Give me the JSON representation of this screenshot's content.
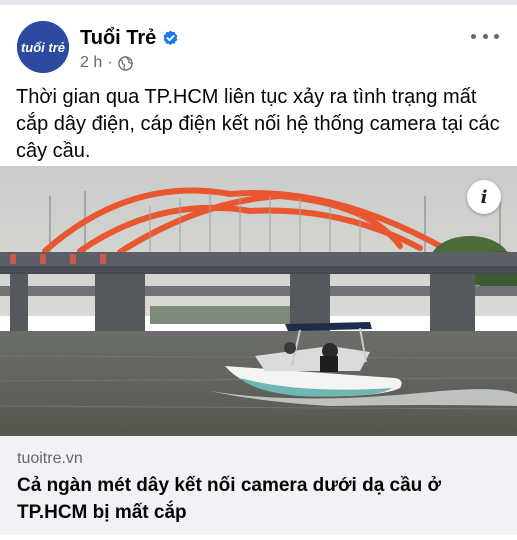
{
  "post": {
    "page_name": "Tuổi Trẻ",
    "avatar_text": "tuổi trẻ",
    "time": "2 h",
    "separator": "·",
    "body": "Thời gian qua TP.HCM liên tục xảy ra tình trạng mất cắp dây điện, cáp điện kết nối hệ thống camera tại các cây cầu."
  },
  "link_preview": {
    "domain": "tuoitre.vn",
    "title": "Cả ngàn mét dây kết nối camera dưới dạ cầu ở TP.HCM bị mất cắp",
    "info_label": "i"
  },
  "colors": {
    "brand_blue": "#2b4aa0",
    "verified_blue": "#1877f2",
    "muted_text": "#65676b",
    "link_bg": "#f0f2f5",
    "bridge_arch": "#e8572f"
  },
  "icons": {
    "verified": "verified-badge-icon",
    "audience": "globe-icon",
    "more": "more-horizontal-icon",
    "info": "info-icon"
  }
}
